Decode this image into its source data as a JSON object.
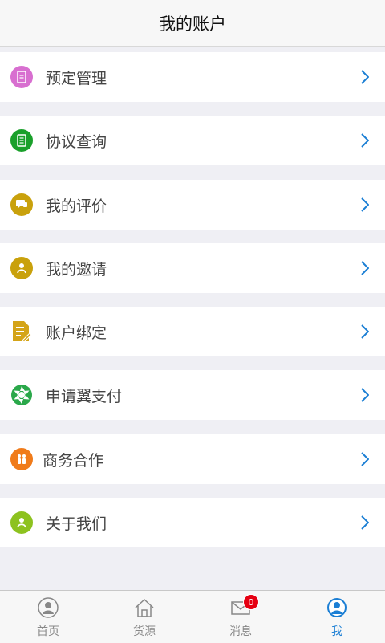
{
  "header": {
    "title": "我的账户"
  },
  "menu": [
    {
      "label": "预定管理",
      "icon": "document-icon",
      "color": "#d86fd0"
    },
    {
      "label": "协议查询",
      "icon": "agreement-icon",
      "color": "#1aa02b"
    },
    {
      "label": "我的评价",
      "icon": "comment-icon",
      "color": "#c9a10c"
    },
    {
      "label": "我的邀请",
      "icon": "invite-icon",
      "color": "#c9a10c"
    },
    {
      "label": "账户绑定",
      "icon": "bind-edit-icon",
      "color": "#d4a418"
    },
    {
      "label": "申请翼支付",
      "icon": "aperture-icon",
      "color": "#2aa84a"
    },
    {
      "label": "商务合作",
      "icon": "business-icon",
      "color": "#f07b1a"
    },
    {
      "label": "关于我们",
      "icon": "about-icon",
      "color": "#8dc21f"
    }
  ],
  "tabs": [
    {
      "label": "首页",
      "icon": "home-user-icon"
    },
    {
      "label": "货源",
      "icon": "house-icon"
    },
    {
      "label": "消息",
      "icon": "mail-icon",
      "badge": "0"
    },
    {
      "label": "我",
      "icon": "me-icon",
      "active": true
    }
  ],
  "colors": {
    "accent": "#1a7ed4",
    "badge": "#e60012",
    "background": "#efeff4"
  }
}
